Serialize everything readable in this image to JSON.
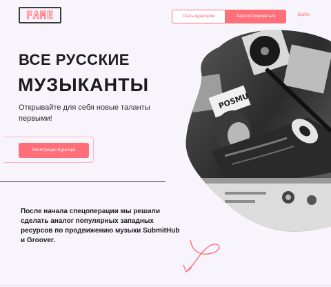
{
  "header": {
    "logo_text": "FAME",
    "become_curator_label": "Стать куратором",
    "register_label": "Зарегистрироваться",
    "login_label": "Войти"
  },
  "hero": {
    "title_line1": "ВСЕ РУССКИЕ",
    "title_line2": "МУЗЫКАНТЫ",
    "subtitle": "Открывайте для себя новые таланты первыми!",
    "cta_label": "Регистрации Куратора",
    "photo_caption": "POSMU"
  },
  "about": {
    "text": "После начала спецоперации мы решили сделать аналог популярных западных ресурсов по продвижению музыки SubmitHub и Groover."
  },
  "colors": {
    "accent": "#ff6f7a",
    "text": "#1b1b1b",
    "background": "#f7f5fb"
  }
}
